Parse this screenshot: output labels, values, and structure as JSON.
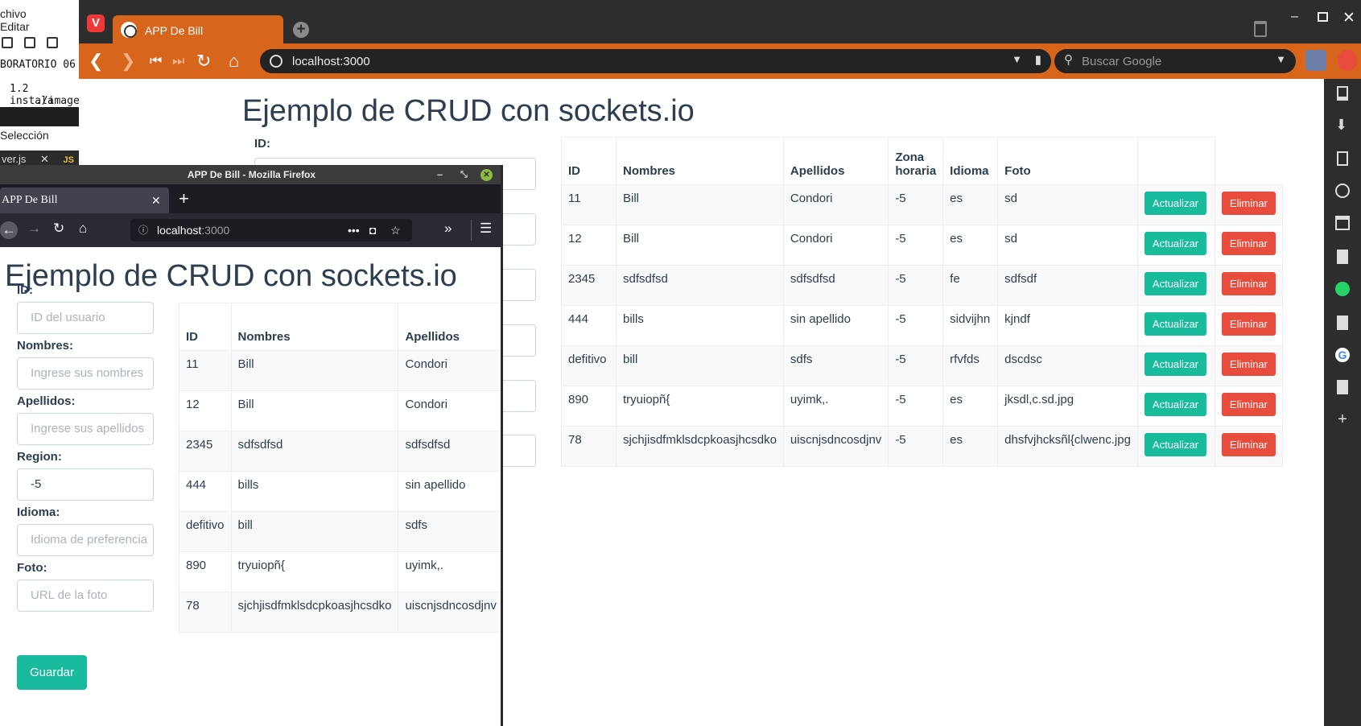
{
  "editor": {
    "menu": [
      "chivo",
      "Editar"
    ],
    "lines": [
      "BORATORIO 06",
      "1.2 instala",
      "./image"
    ],
    "menu2": [
      "Selección",
      "V"
    ],
    "file_tab": "ver.js",
    "file_badge": "JS"
  },
  "vivaldi": {
    "tab_title": "APP De Bill",
    "url": "localhost:3000",
    "search_placeholder": "Buscar Google"
  },
  "firefox": {
    "window_title": "APP De Bill - Mozilla Firefox",
    "tab_title": "APP De Bill",
    "url": "localhost",
    "url_port": ":3000"
  },
  "page": {
    "title": "Ejemplo de CRUD con sockets.io",
    "form": {
      "id_label": "ID:",
      "id_placeholder": "ID del usuario",
      "nombres_label": "Nombres:",
      "nombres_placeholder": "Ingrese sus nombres",
      "apellidos_label": "Apellidos:",
      "apellidos_placeholder": "Ingrese sus apellidos",
      "region_label": "Region:",
      "region_value": "-5",
      "idioma_label": "Idioma:",
      "idioma_placeholder": "Idioma de preferencia",
      "foto_label": "Foto:",
      "foto_placeholder": "URL de la foto",
      "save_label": "Guardar"
    },
    "table": {
      "headers": [
        "ID",
        "Nombres",
        "Apellidos",
        "Zona horaria",
        "Idioma",
        "Foto"
      ],
      "update_label": "Actualizar",
      "delete_label": "Eliminar",
      "rows": [
        {
          "id": "11",
          "nombres": "Bill",
          "apellidos": "Condori",
          "zona": "-5",
          "idioma": "es",
          "foto": "sd"
        },
        {
          "id": "12",
          "nombres": "Bill",
          "apellidos": "Condori",
          "zona": "-5",
          "idioma": "es",
          "foto": "sd"
        },
        {
          "id": "2345",
          "nombres": "sdfsdfsd",
          "apellidos": "sdfsdfsd",
          "zona": "-5",
          "idioma": "fe",
          "foto": "sdfsdf"
        },
        {
          "id": "444",
          "nombres": "bills",
          "apellidos": "sin apellido",
          "zona": "-5",
          "idioma": "sidvijhn",
          "foto": "kjndf"
        },
        {
          "id": "defitivo",
          "nombres": "bill",
          "apellidos": "sdfs",
          "zona": "-5",
          "idioma": "rfvfds",
          "foto": "dscdsc"
        },
        {
          "id": "890",
          "nombres": "tryuiopñ{",
          "apellidos": "uyimk,.",
          "zona": "-5",
          "idioma": "es",
          "foto": "jksdl,c.sd.jpg"
        },
        {
          "id": "78",
          "nombres": "sjchjisdfmklsdcpkoasjhcsdko",
          "apellidos": "uiscnjsdncosdjnv",
          "zona": "-5",
          "idioma": "es",
          "foto": "dhsfvjhcksñl{clwenc.jpg"
        }
      ]
    }
  }
}
